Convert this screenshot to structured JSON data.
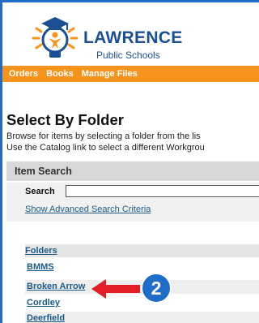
{
  "logo": {
    "title": "LAWRENCE",
    "subtitle": "Public Schools"
  },
  "nav": {
    "items": [
      {
        "label": "Orders"
      },
      {
        "label": "Books"
      },
      {
        "label": "Manage Files"
      }
    ]
  },
  "page": {
    "title": "Select By Folder",
    "description_line1": "Browse for items by selecting a folder from the lis",
    "description_line2": "Use the Catalog link to select a different Workgrou"
  },
  "item_search": {
    "header": "Item Search",
    "search_label": "Search",
    "search_value": "",
    "advanced_link": "Show Advanced Search Criteria"
  },
  "folders": {
    "header": "Folders",
    "items": [
      {
        "label": "BMMS"
      },
      {
        "label": "Broken Arrow"
      },
      {
        "label": "Cordley"
      },
      {
        "label": "Deerfield"
      }
    ]
  },
  "annotation": {
    "number": "2"
  },
  "colors": {
    "frame_border": "#1f6cc9",
    "nav_bg": "#f7941d",
    "brand_blue": "#1b4f94",
    "arrow_red": "#e41e26",
    "badge_blue": "#1f6cc9"
  }
}
